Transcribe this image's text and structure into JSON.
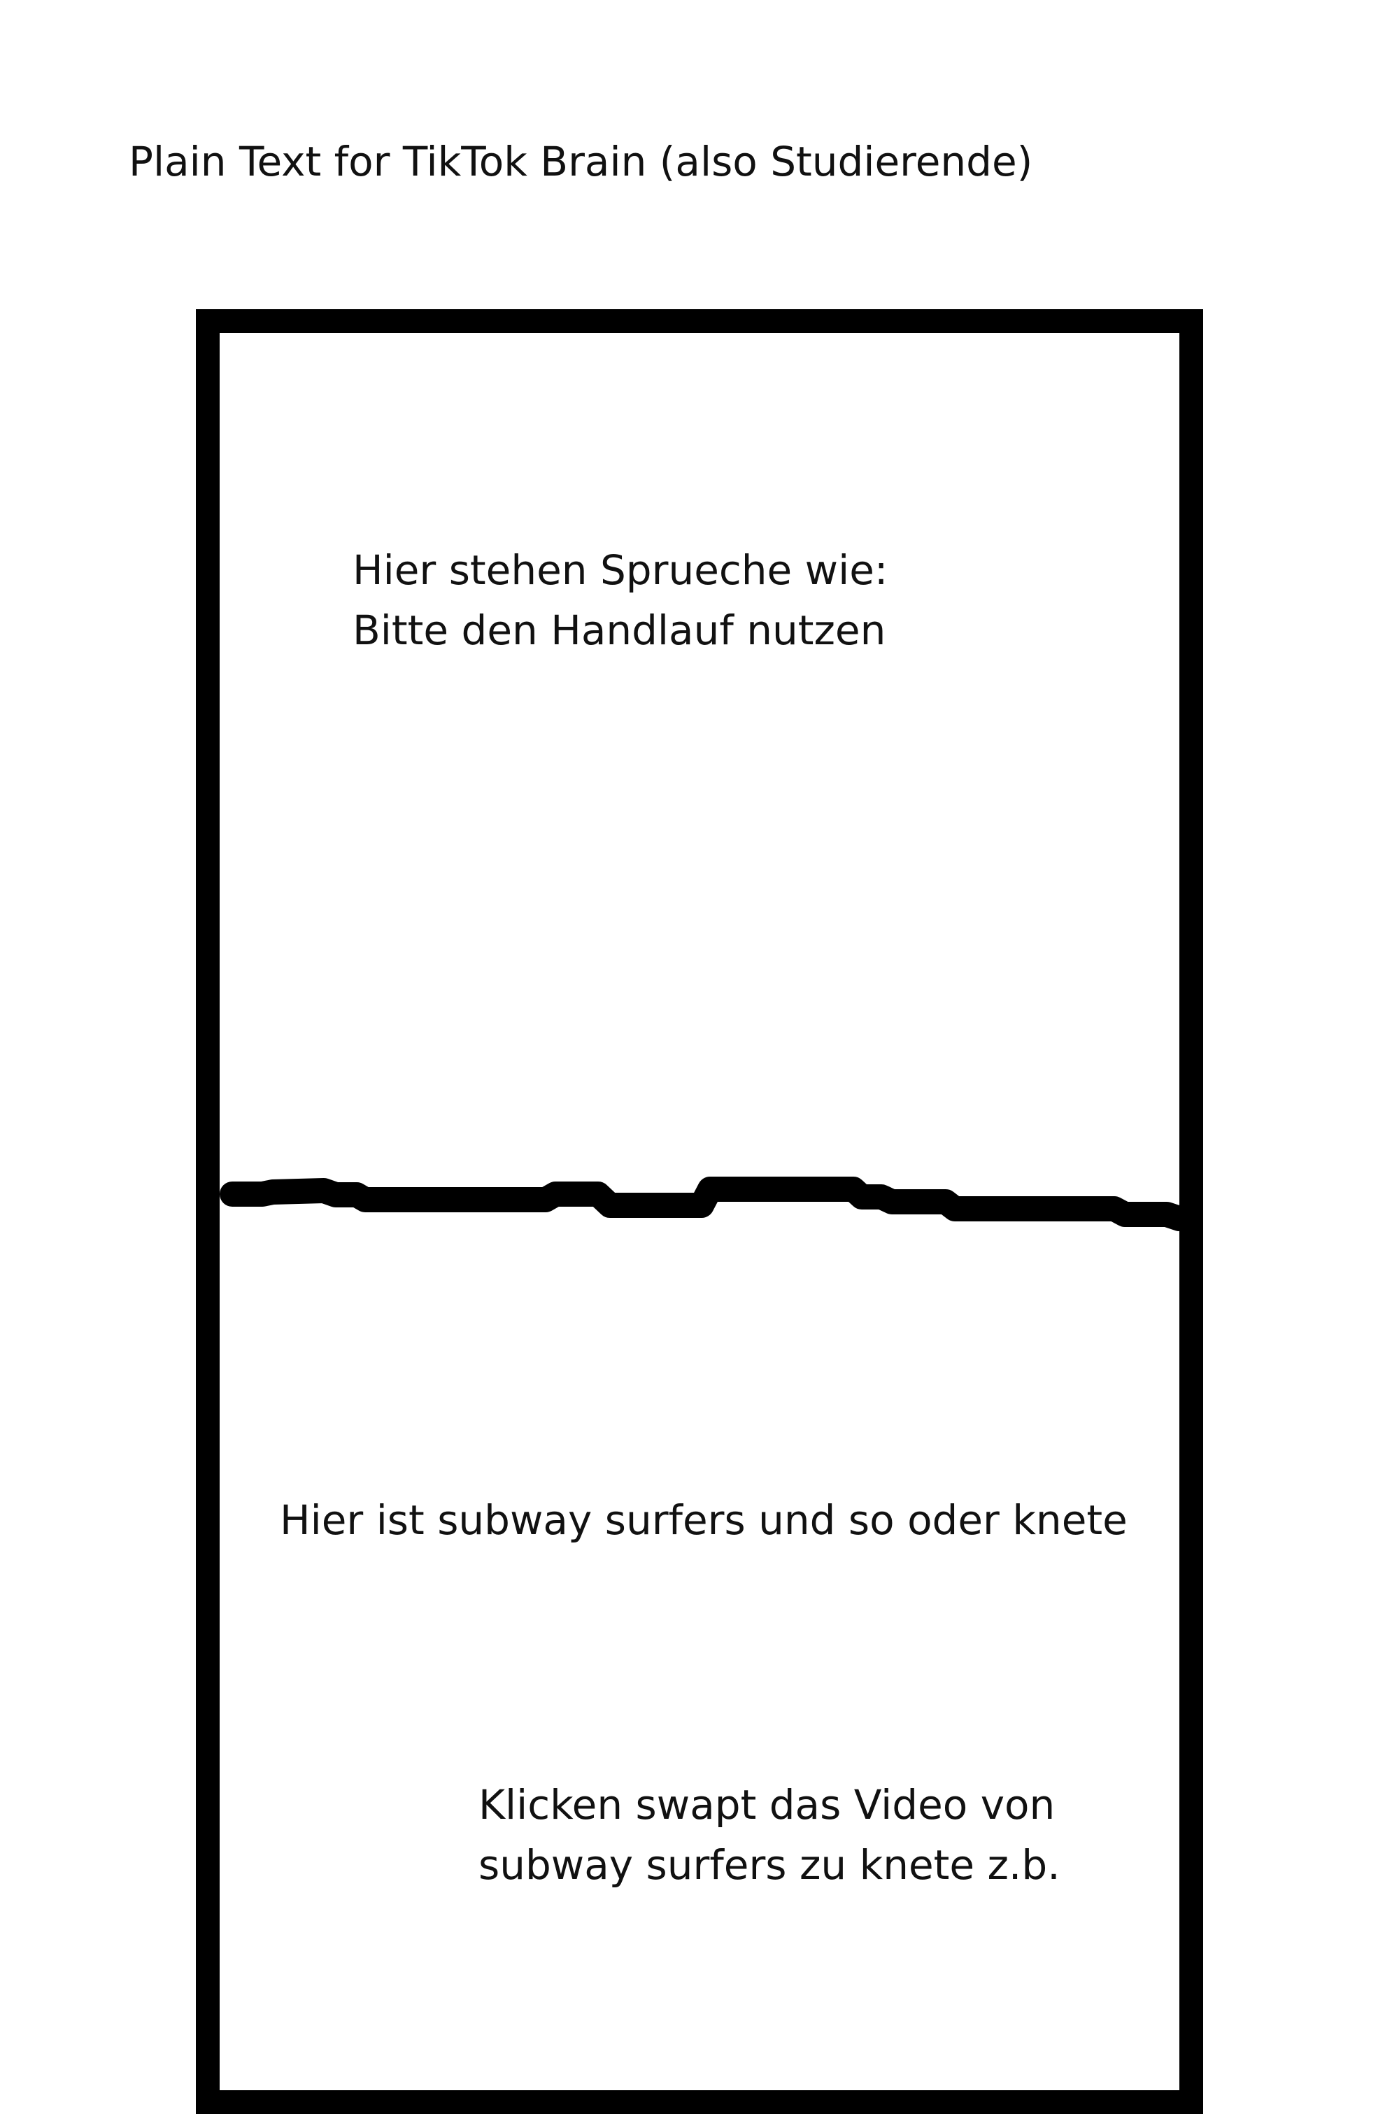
{
  "page": {
    "title": "Plain Text for TikTok Brain (also Studierende)"
  },
  "top_section": {
    "lines": [
      "Hier stehen Sprueche wie:",
      "Bitte den Handlauf nutzen"
    ]
  },
  "bottom_section": {
    "main_text": "Hier ist subway surfers und so oder knete",
    "note_lines": [
      "Klicken swapt das Video von",
      "subway surfers zu knete z.b."
    ]
  },
  "colors": {
    "line": "#000000",
    "background": "#ffffff",
    "text": "#111111"
  }
}
